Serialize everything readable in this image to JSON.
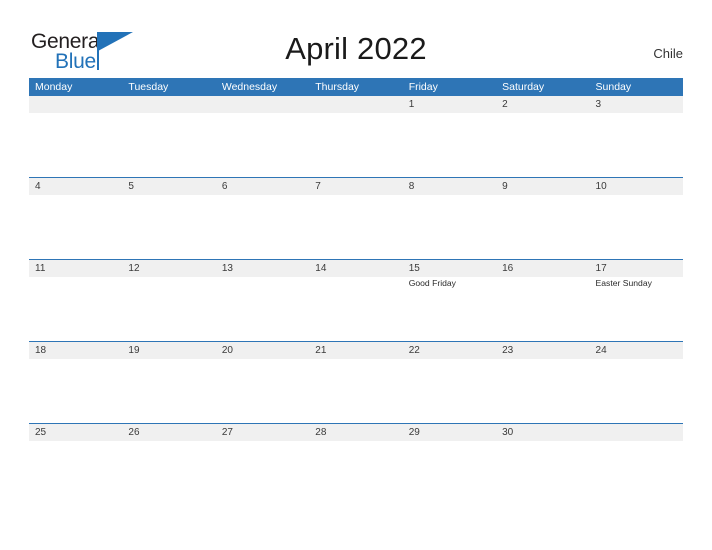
{
  "brand": {
    "name_part1": "General",
    "name_part2": "Blue",
    "accent_color": "#2272b8"
  },
  "header": {
    "title": "April 2022",
    "country": "Chile"
  },
  "theme": {
    "header_blue": "#2e75b6",
    "band_gray": "#f0f0f0",
    "page_background": "#ffffff",
    "rule_blue": "#2e75b6"
  },
  "calendar": {
    "month": "April",
    "year": "2022",
    "weekdays": [
      "Monday",
      "Tuesday",
      "Wednesday",
      "Thursday",
      "Friday",
      "Saturday",
      "Sunday"
    ],
    "weeks": [
      {
        "dates": [
          "",
          "",
          "",
          "",
          "1",
          "2",
          "3"
        ],
        "events": [
          "",
          "",
          "",
          "",
          "",
          "",
          ""
        ]
      },
      {
        "dates": [
          "4",
          "5",
          "6",
          "7",
          "8",
          "9",
          "10"
        ],
        "events": [
          "",
          "",
          "",
          "",
          "",
          "",
          ""
        ]
      },
      {
        "dates": [
          "11",
          "12",
          "13",
          "14",
          "15",
          "16",
          "17"
        ],
        "events": [
          "",
          "",
          "",
          "",
          "Good Friday",
          "",
          "Easter Sunday"
        ]
      },
      {
        "dates": [
          "18",
          "19",
          "20",
          "21",
          "22",
          "23",
          "24"
        ],
        "events": [
          "",
          "",
          "",
          "",
          "",
          "",
          ""
        ]
      },
      {
        "dates": [
          "25",
          "26",
          "27",
          "28",
          "29",
          "30",
          ""
        ],
        "events": [
          "",
          "",
          "",
          "",
          "",
          "",
          ""
        ]
      }
    ]
  }
}
